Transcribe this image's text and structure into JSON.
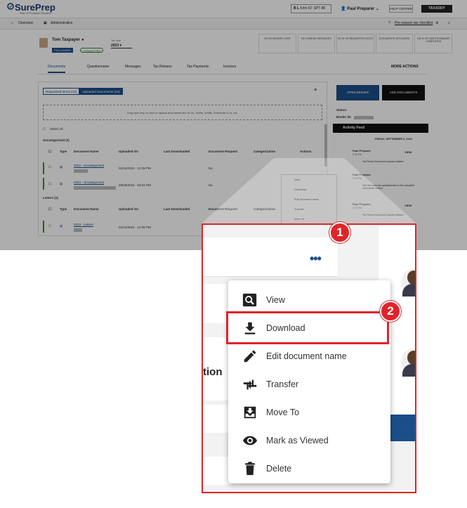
{
  "app": {
    "logo": "SurePrep",
    "logo_sub": "Part of Thomson Reuters",
    "firm_id": "Firm ID: SPT-80",
    "firm_mark": "B L",
    "user": "Paul Preparer",
    "help": "HELP CENTER",
    "taxaddy": "TAXADDY"
  },
  "subnav": {
    "overview": "Overview",
    "administrative": "Administrative",
    "checklist": "Pre-season tax checklist"
  },
  "profile": {
    "name": "Tom Taxpayer",
    "following": "FOLLOWING",
    "connected": "CONNECTED",
    "tax_year_label": "Tax Year",
    "tax_year": "2023",
    "stats": [
      "GO\nNO BINDER LOGS",
      "NO UNREAD MESSAGES",
      "30 OF 49\nREQUESTED DOCS",
      "DOCUMENTS UPLOADED",
      "100 %\nOF QUESTIONNAIRE COMPLETED"
    ]
  },
  "tabs": [
    "Documents",
    "Questionnaire",
    "Messages",
    "Tax Returns",
    "Tax Payments",
    "Invoices"
  ],
  "more_actions": "MORE ACTIONS",
  "docs": {
    "segment_a": "Requested Items (43)",
    "segment_b": "Uploaded Documents (10)",
    "dropzone": "Drag and drop or click to upload documents like W-2s, 1099s, 1098s, Schedule K-1s, etc.",
    "select_all": "Select All",
    "group1": "Uncategorized",
    "group1_count": "(2)",
    "group2": "Letters",
    "group2_count": "(1)",
    "headers": [
      "Type",
      "Document Name",
      "Uploaded On",
      "Last Downloaded",
      "Document Request",
      "Categorization",
      "Actions"
    ],
    "rows": [
      {
        "name": "2023 - Uncategorized",
        "uploaded": "02/12/2024 - 12:29 PM",
        "request": "No"
      },
      {
        "name": "2023 - Uncategorized",
        "uploaded": "09/05/2024 - 03:04 PM",
        "request": "No"
      },
      {
        "name": "2023 - Letters",
        "uploaded": "02/12/2024 - 12:09 PM",
        "request": ""
      }
    ]
  },
  "side": {
    "open_binder": "OPEN BINDER",
    "add_documents": "ADD DOCUMENTS",
    "status_label": "Status:",
    "binder_label": "Binder ID:",
    "activity_feed": "Activity Feed",
    "date": "FRIDAY, SEPTEMBER 6, 2024",
    "entries": [
      {
        "who": "Paul Preparer",
        "time": "2:35 PM",
        "view": "VIEW",
        "text": "Tax Return Document upload initiated."
      },
      {
        "who": "Paul Preparer",
        "time": "2:34 PM",
        "view": "",
        "text": "Has filed your tax questionnaire in the uploaded documents section."
      },
      {
        "who": "Paul Preparer",
        "time": "2:33 PM",
        "view": "VIEW",
        "text": "Tax Return Document upload initiated."
      }
    ]
  },
  "menu": {
    "items": [
      {
        "label": "View",
        "icon": "search-icon"
      },
      {
        "label": "Download",
        "icon": "download-icon"
      },
      {
        "label": "Edit document name",
        "icon": "pencil-icon"
      },
      {
        "label": "Transfer",
        "icon": "transfer-icon"
      },
      {
        "label": "Move To",
        "icon": "move-to-icon"
      },
      {
        "label": "Mark as Viewed",
        "icon": "eye-icon"
      },
      {
        "label": "Delete",
        "icon": "trash-icon"
      }
    ]
  },
  "zoom": {
    "partial_text": "tion"
  },
  "callouts": [
    "1",
    "2"
  ],
  "colors": {
    "accent": "#1a4e8a",
    "callout": "#e0242b"
  }
}
